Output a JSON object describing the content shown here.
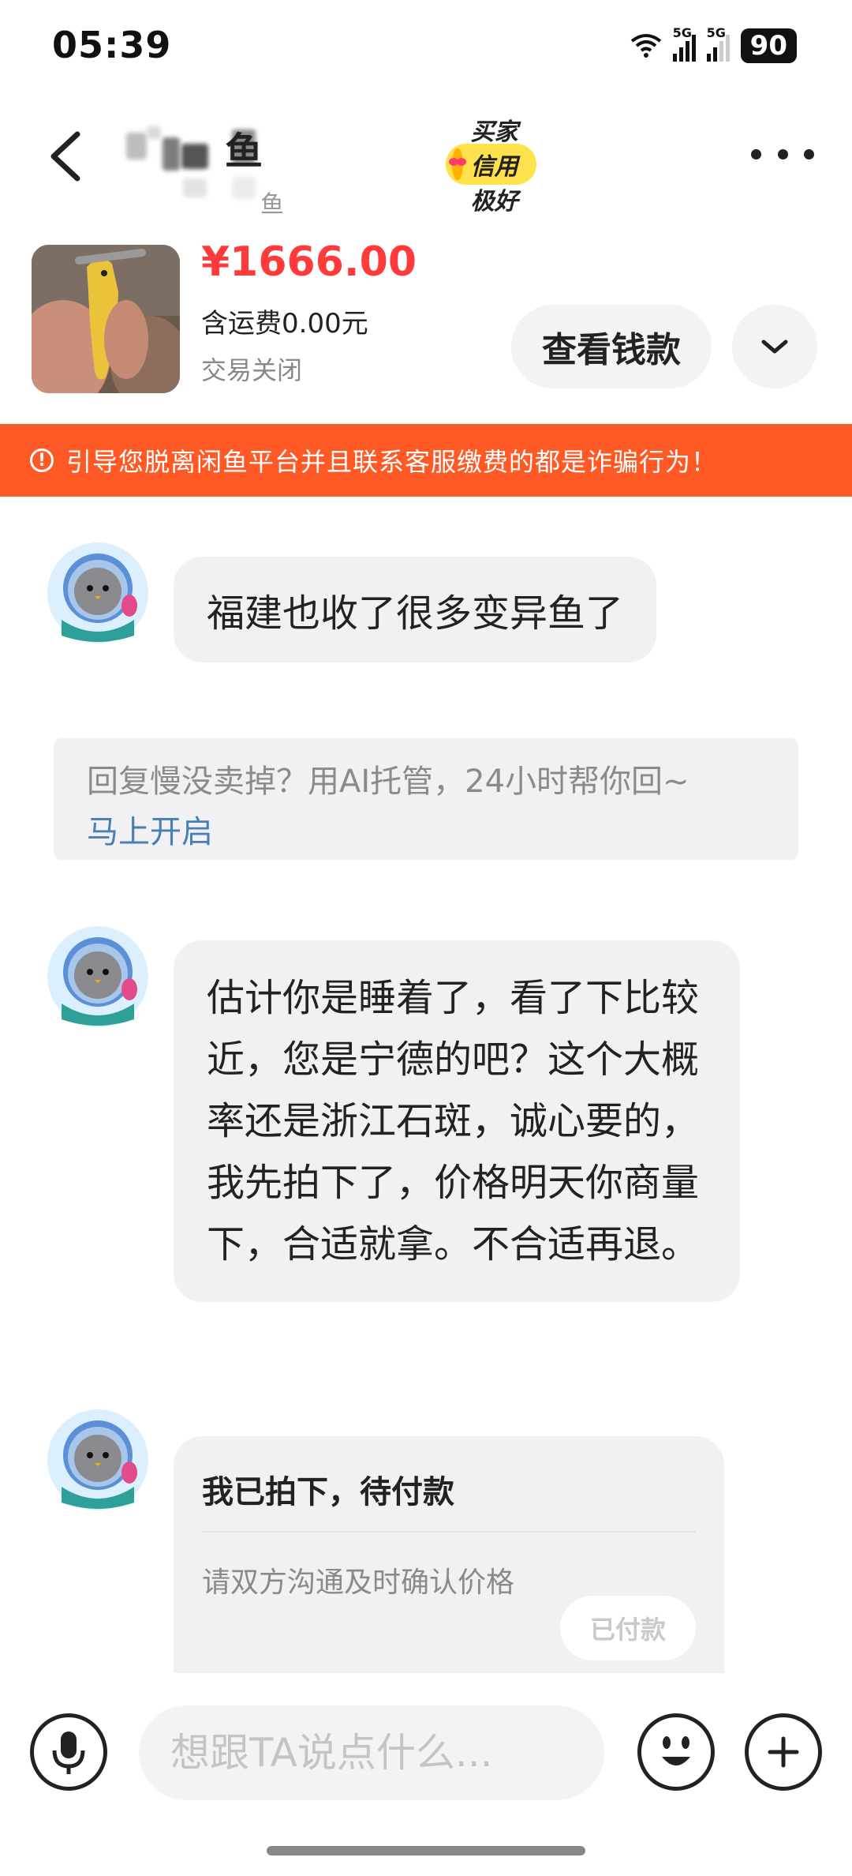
{
  "status_bar": {
    "time": "05:39",
    "battery": "90",
    "network_1": "5G",
    "network_2": "5G",
    "icons": [
      "wifi-icon",
      "signal-icon",
      "signal-icon",
      "battery-icon"
    ]
  },
  "header": {
    "title_visible": "鱼",
    "subtitle_visible": "鱼",
    "badge_label": "买家信用极好",
    "icons": [
      "back-icon",
      "more-icon"
    ]
  },
  "product": {
    "price": "¥1666.00",
    "shipping": "含运费0.00元",
    "status": "交易关闭",
    "view_button": "查看钱款",
    "icons": [
      "chevron-down-icon"
    ]
  },
  "warning": {
    "text": "引导您脱离闲鱼平台并且联系客服缴费的都是诈骗行为！",
    "icon": "alert-icon"
  },
  "messages": [
    {
      "text": "福建也收了很多变异鱼了"
    },
    {
      "text": "估计你是睡着了，看了下比较近，您是宁德的吧？这个大概率还是浙江石斑，诚心要的，我先拍下了，价格明天你商量下，合适就拿。不合适再退。"
    }
  ],
  "ai_tip": {
    "text": "回复慢没卖掉？用AI托管，24小时帮你回~",
    "link": "马上开启"
  },
  "order_card": {
    "title": "我已拍下，待付款",
    "desc": "请双方沟通及时确认价格",
    "button": "已付款"
  },
  "input_bar": {
    "placeholder": "想跟TA说点什么...",
    "icons": [
      "microphone-icon",
      "emoji-icon",
      "plus-icon"
    ]
  },
  "colors": {
    "price_red": "#ff3a3a",
    "warning_orange": "#ff5a26",
    "badge_yellow": "#ffe14b",
    "link_blue": "#4a7fb5"
  }
}
